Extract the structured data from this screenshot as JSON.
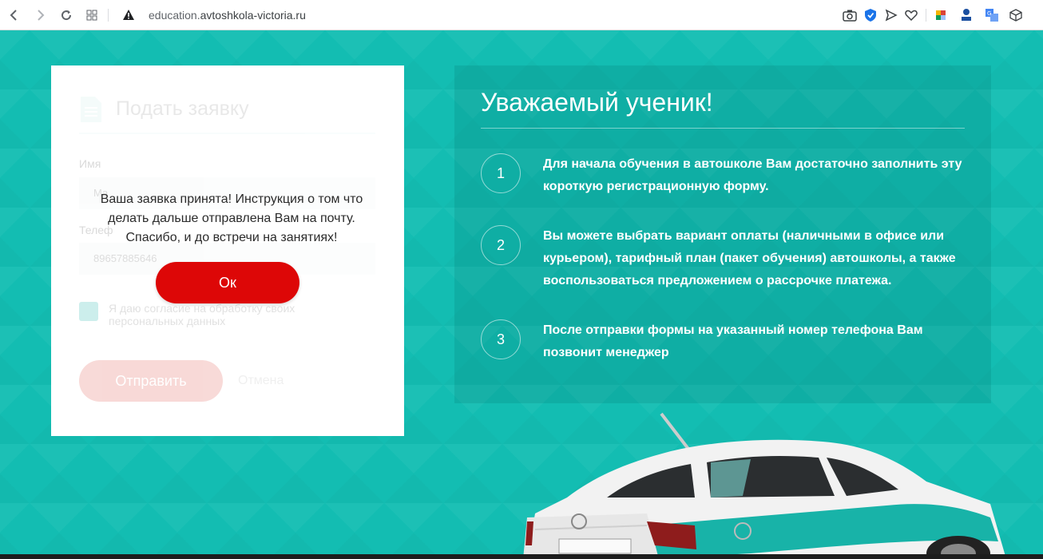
{
  "browser": {
    "url_domain": "education.",
    "url_host": "avtoshkola-victoria.ru"
  },
  "form": {
    "title": "Подать заявку",
    "name_label": "Имя",
    "name_value": "Ма",
    "phone_label": "Телеф",
    "phone_value": "89657885646",
    "consent_text": "Я даю согласие на обработку своих персональных данных",
    "submit_label": "Отправить",
    "cancel_label": "Отмена"
  },
  "modal": {
    "message": "Ваша заявка принята! Инструкция о том что делать дальше отправлена Вам на почту. Спасибо, и до встречи на занятиях!",
    "ok_label": "Ок"
  },
  "info": {
    "title": "Уважаемый ученик!",
    "steps": [
      {
        "num": "1",
        "text": "Для начала обучения в автошколе Вам достаточно заполнить эту короткую регистрационную форму."
      },
      {
        "num": "2",
        "text": "Вы можете выбрать вариант оплаты (наличными в офисе или курьером), тарифный план (пакет обучения) автошколы, а также воспользоваться предложением о рассрочке платежа."
      },
      {
        "num": "3",
        "text": "После отправки формы на указанный номер телефона Вам позвонит менеджер"
      }
    ]
  },
  "colors": {
    "background": "#13bdb2",
    "ok_button": "#dd0707",
    "accent": "#18b3a8"
  }
}
